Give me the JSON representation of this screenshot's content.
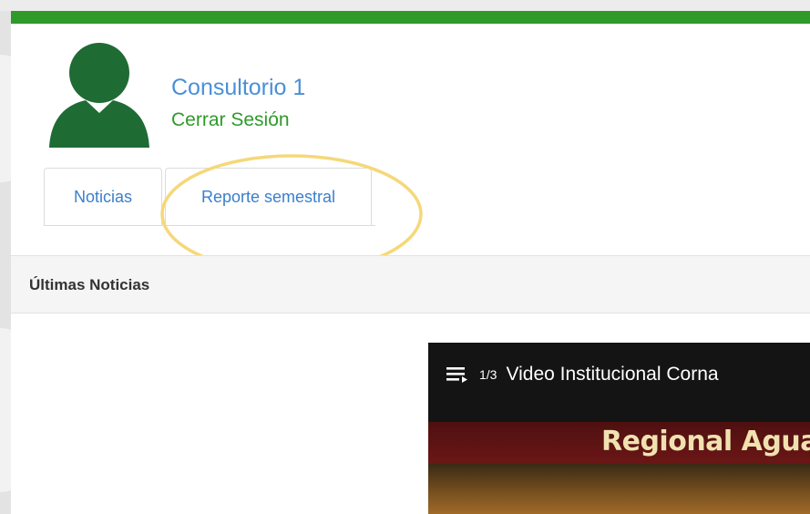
{
  "user": {
    "name": "Consultorio 1",
    "logout_label": "Cerrar Sesión"
  },
  "tabs": [
    {
      "label": "Noticias"
    },
    {
      "label": "Reporte semestral"
    }
  ],
  "section": {
    "title": "Últimas Noticias"
  },
  "video": {
    "counter": "1/3",
    "title": "Video Institucional Corna",
    "banner_text": "Regional Aguas"
  },
  "colors": {
    "brand_green": "#2f9a2a",
    "link_blue": "#4a8fd6",
    "highlight": "#f5d87a"
  },
  "icons": [
    "user-avatar-icon",
    "playlist-icon"
  ]
}
